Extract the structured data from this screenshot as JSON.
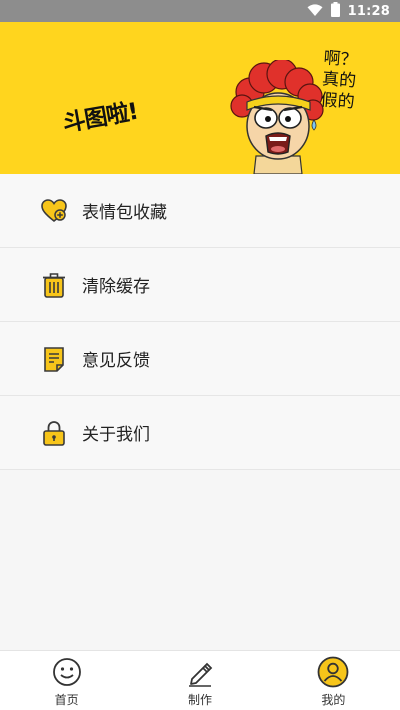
{
  "status_bar": {
    "time": "11:28",
    "icons": [
      "wifi-icon",
      "battery-icon"
    ]
  },
  "banner": {
    "title": "斗图啦!",
    "speech": "啊？真的假的",
    "background": "#ffd51e"
  },
  "menu": {
    "items": [
      {
        "label": "表情包收藏",
        "icon": "heart-plus-icon"
      },
      {
        "label": "清除缓存",
        "icon": "trash-icon"
      },
      {
        "label": "意见反馈",
        "icon": "note-icon"
      },
      {
        "label": "关于我们",
        "icon": "lock-icon"
      }
    ]
  },
  "tabs": [
    {
      "label": "首页",
      "icon": "smiley-icon"
    },
    {
      "label": "制作",
      "icon": "pencil-icon"
    },
    {
      "label": "我的",
      "icon": "user-icon",
      "active": true
    }
  ],
  "colors": {
    "accent": "#f7c51a",
    "icon_stroke": "#3a3a3a"
  }
}
